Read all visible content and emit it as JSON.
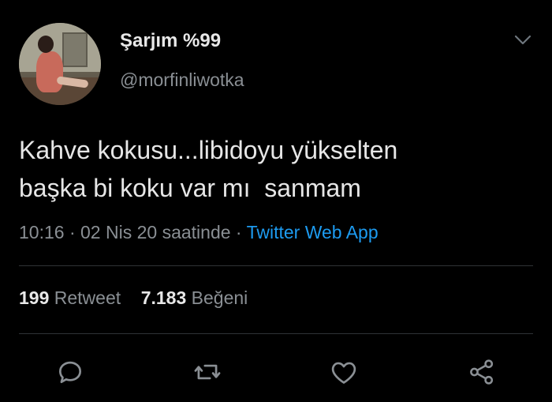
{
  "author": {
    "display_name": "Şarjım %99",
    "handle": "@morfinliwotka"
  },
  "tweet": {
    "line1": "Kahve kokusu...libidoyu yükselten",
    "line2": "başka bi koku var mı  sanmam",
    "time": "10:16",
    "date": "02 Nis 20 saatinde",
    "separator": "·",
    "source": "Twitter Web App"
  },
  "stats": {
    "retweet_count": "199",
    "retweet_label": "Retweet",
    "like_count": "7.183",
    "like_label": "Beğeni"
  },
  "colors": {
    "background": "#000000",
    "text": "#e6e6e6",
    "muted": "#8a8f94",
    "link": "#1d9bf0",
    "divider": "#2f3336"
  },
  "icons": [
    "chevron-down-icon",
    "reply-icon",
    "retweet-icon",
    "like-icon",
    "share-icon"
  ]
}
